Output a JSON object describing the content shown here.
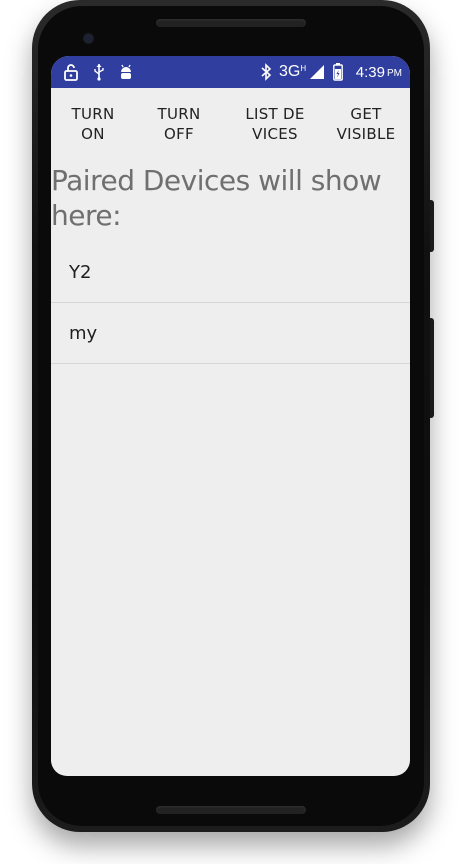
{
  "status_bar": {
    "network": "3G",
    "network_sup": "H",
    "time": "4:39",
    "ampm": "PM",
    "icons": [
      "lock-open-icon",
      "usb-icon",
      "android-debug-icon",
      "bluetooth-icon",
      "signal-icon",
      "battery-icon"
    ],
    "color": "#303f9f"
  },
  "toolbar": {
    "turn_on": "TURN ON",
    "turn_off": "TURN OFF",
    "list_devices": "LIST DEVICES",
    "get_visible": "GET VISIBLE"
  },
  "heading": "Paired Devices will show here:",
  "devices": [
    {
      "name": "Y2"
    },
    {
      "name": "my"
    }
  ],
  "colors": {
    "screen_bg": "#eeeeee",
    "accent": "#303f9f",
    "heading_text": "#6f6f6f"
  }
}
